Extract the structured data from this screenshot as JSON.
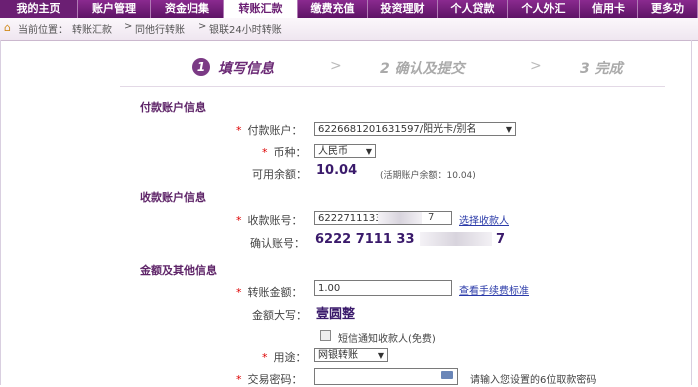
{
  "nav": {
    "tabs": [
      {
        "label": "我的主页"
      },
      {
        "label": "账户管理"
      },
      {
        "label": "资金归集"
      },
      {
        "label": "转账汇款"
      },
      {
        "label": "缴费充值"
      },
      {
        "label": "投资理财"
      },
      {
        "label": "个人贷款"
      },
      {
        "label": "个人外汇"
      },
      {
        "label": "信用卡"
      },
      {
        "label": "更多功"
      }
    ]
  },
  "breadcrumb": {
    "prefix": "当前位置：",
    "items": [
      "转账汇款",
      "同他行转账",
      "银联24小时转账"
    ],
    "sep": ">"
  },
  "steps": {
    "step1_num": "1",
    "step1_label": "填写信息",
    "step2_label": "2 确认及提交",
    "step3_label": "3 完成",
    "arrow": ">"
  },
  "payer": {
    "section_title": "付款账户信息",
    "account_label": "付款账户：",
    "account_value": "6226681201631597/阳光卡/别名",
    "currency_label": "币种：",
    "currency_value": "人民币",
    "balance_label": "可用余额：",
    "balance_value": "10.04",
    "balance_note": "(活期账户余额：10.04)"
  },
  "payee": {
    "section_title": "收款账户信息",
    "account_label": "收款账号：",
    "account_value_left": "6222711133",
    "account_value_right": "7",
    "select_link": "选择收款人",
    "confirm_label": "确认账号：",
    "confirm_value_left": "6222 7111 33",
    "confirm_value_right": "7"
  },
  "amount": {
    "section_title": "金额及其他信息",
    "amount_label": "转账金额：",
    "amount_value": "1.00",
    "fee_link": "查看手续费标准",
    "capital_label": "金额大写：",
    "capital_value": "壹圆整",
    "sms_label": "短信通知收款人(免费)",
    "purpose_label": "用途：",
    "purpose_value": "网银转账",
    "password_label": "交易密码：",
    "password_hint": "请输入您设置的6位取款密码"
  },
  "colors": {
    "nav": "#6b1f73",
    "accent": "#5e2468",
    "link": "#2a3aa8",
    "required": "#dd0000"
  }
}
